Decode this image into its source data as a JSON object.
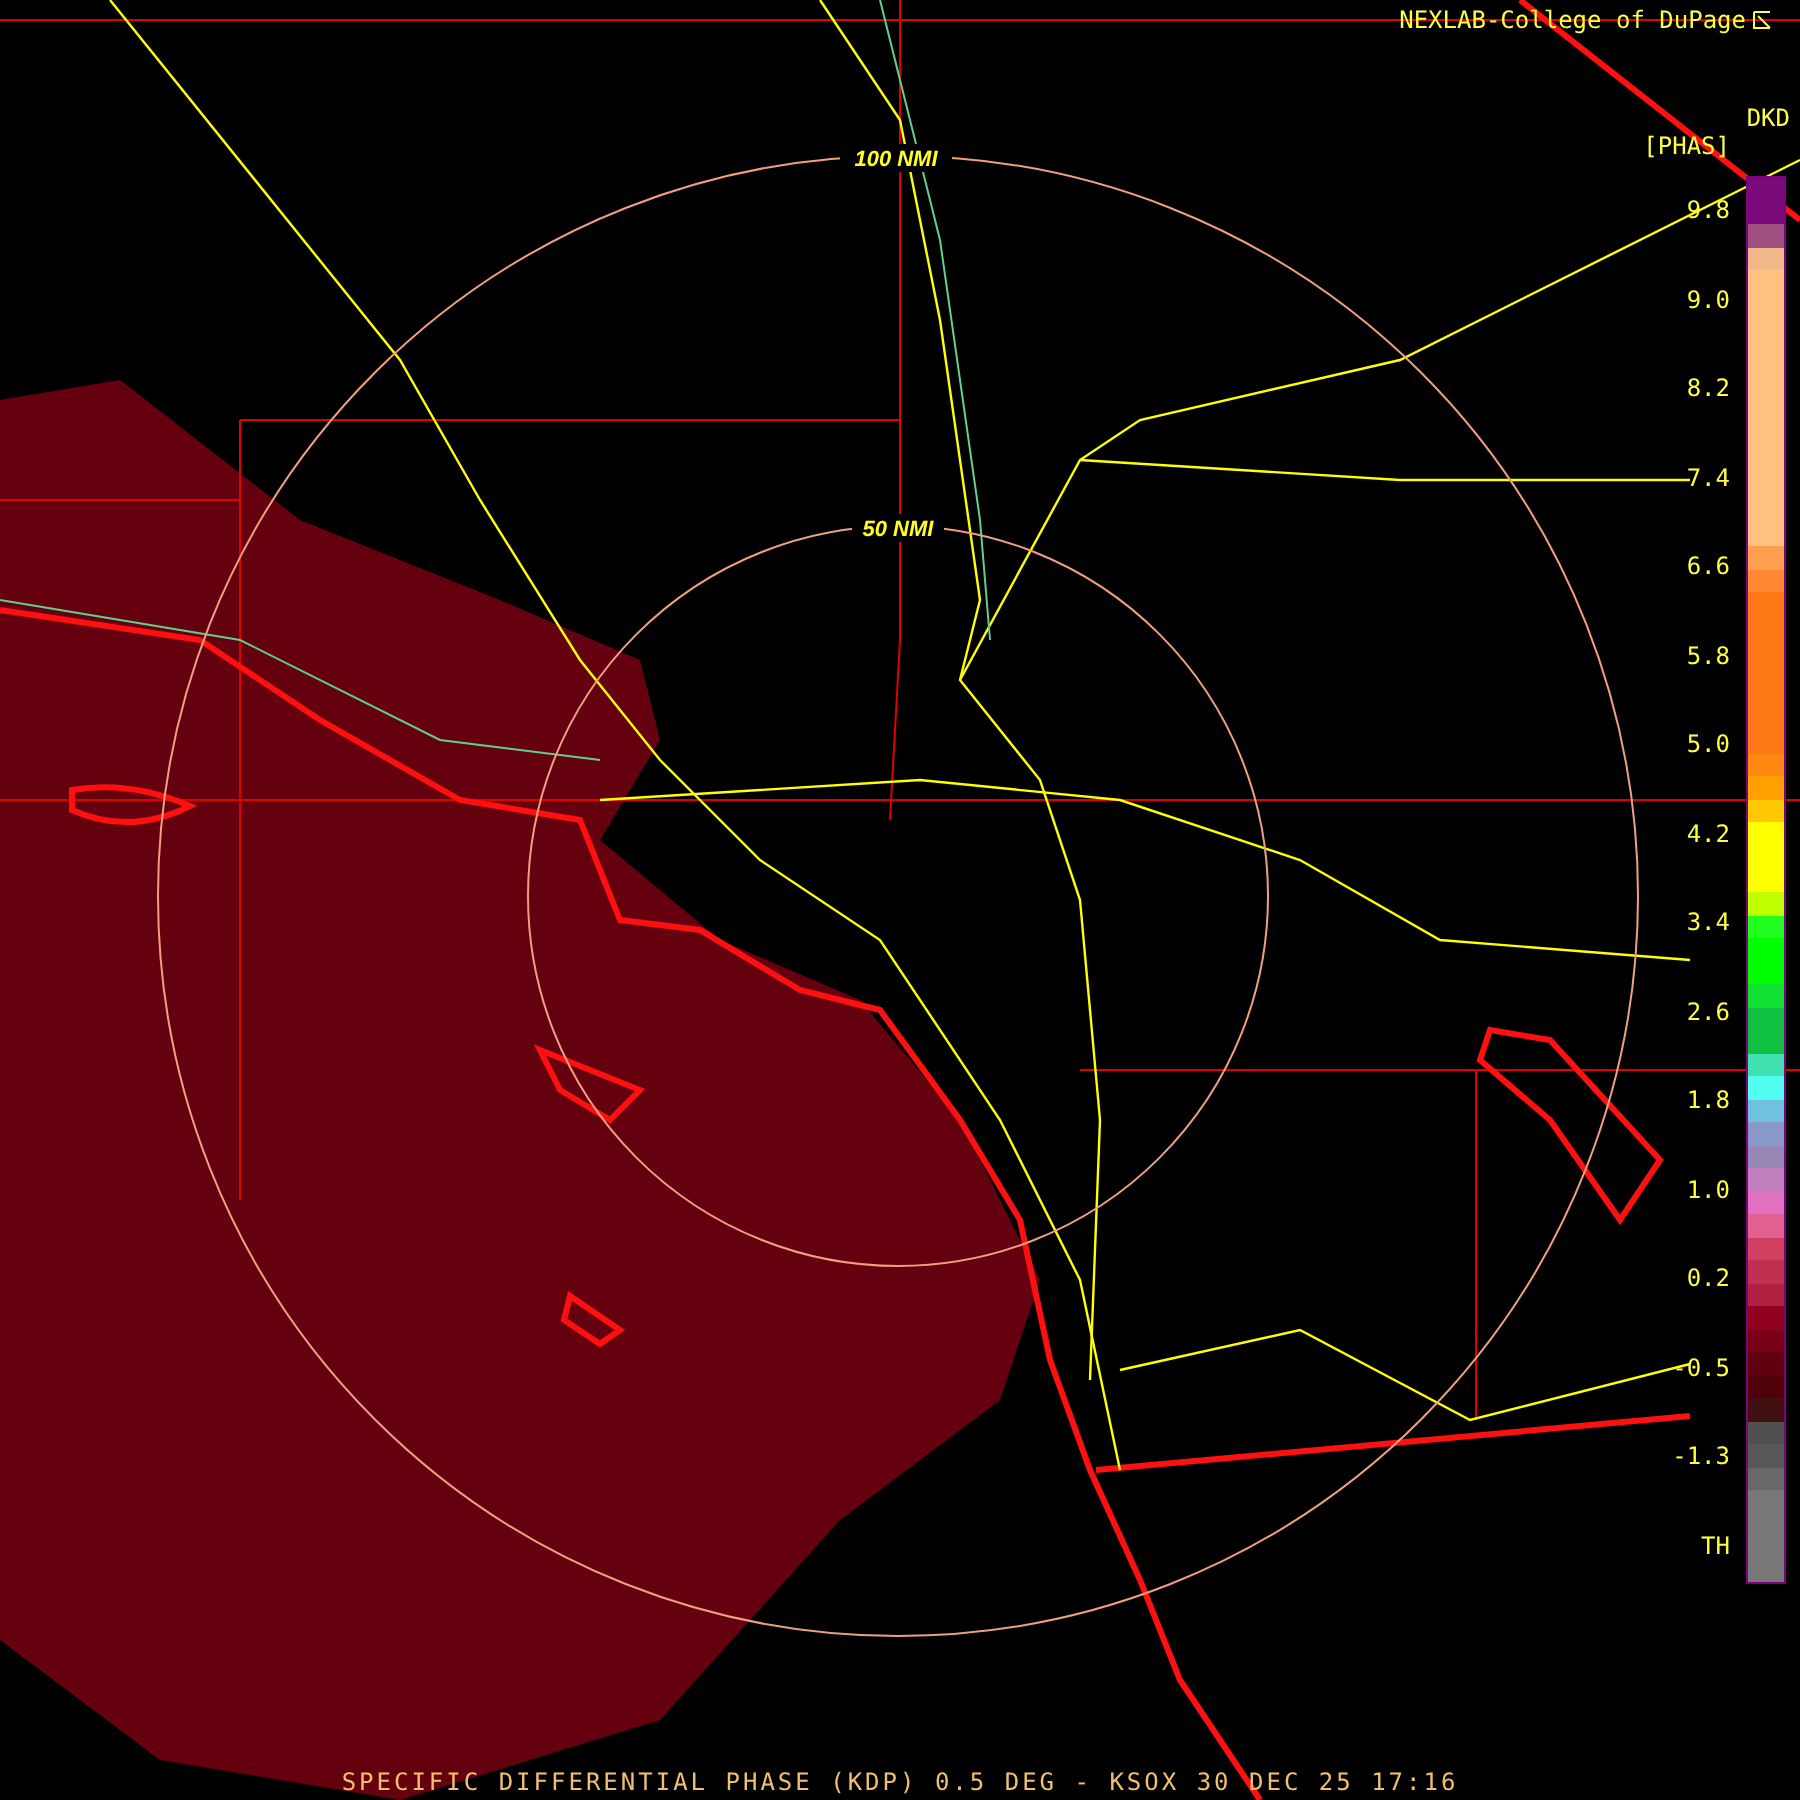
{
  "header": {
    "credit": "NEXLAB-College of DuPage"
  },
  "rings": [
    {
      "label": "100 NMI"
    },
    {
      "label": "50 NMI"
    }
  ],
  "legend": {
    "product": "DKD",
    "unit": "[PHAS]",
    "ticks": [
      "9.8",
      "9.0",
      "8.2",
      "7.4",
      "6.6",
      "5.8",
      "5.0",
      "4.2",
      "3.4",
      "2.6",
      "1.8",
      "1.0",
      "0.2",
      "-0.5",
      "-1.3",
      "TH"
    ],
    "bands": [
      {
        "color": "#7a0a7a"
      },
      {
        "color": "#7a0a7a"
      },
      {
        "color": "#a05080"
      },
      {
        "color": "#f0b888"
      },
      {
        "color": "#ffc080"
      },
      {
        "color": "#ffc080"
      },
      {
        "color": "#ffc080"
      },
      {
        "color": "#ffc080"
      },
      {
        "color": "#ffc080"
      },
      {
        "color": "#ffc080"
      },
      {
        "color": "#ffc080"
      },
      {
        "color": "#ffc080"
      },
      {
        "color": "#ffc080"
      },
      {
        "color": "#ffc080"
      },
      {
        "color": "#ffc080"
      },
      {
        "color": "#ffc080"
      },
      {
        "color": "#ffa050"
      },
      {
        "color": "#ff8830"
      },
      {
        "color": "#ff7818"
      },
      {
        "color": "#ff7818"
      },
      {
        "color": "#ff7818"
      },
      {
        "color": "#ff7818"
      },
      {
        "color": "#ff7818"
      },
      {
        "color": "#ff7818"
      },
      {
        "color": "#ff7818"
      },
      {
        "color": "#ff8810"
      },
      {
        "color": "#ffa000"
      },
      {
        "color": "#ffc800"
      },
      {
        "color": "#ffff00"
      },
      {
        "color": "#ffff00"
      },
      {
        "color": "#ffff00"
      },
      {
        "color": "#c0ff00"
      },
      {
        "color": "#20ff20"
      },
      {
        "color": "#00ff00"
      },
      {
        "color": "#00ff00"
      },
      {
        "color": "#10e030"
      },
      {
        "color": "#10c040"
      },
      {
        "color": "#10c040"
      },
      {
        "color": "#40e0b0"
      },
      {
        "color": "#50fff0"
      },
      {
        "color": "#70c0e0"
      },
      {
        "color": "#8898c8"
      },
      {
        "color": "#9888b8"
      },
      {
        "color": "#c080c0"
      },
      {
        "color": "#e070c0"
      },
      {
        "color": "#e06090"
      },
      {
        "color": "#d04060"
      },
      {
        "color": "#c03050"
      },
      {
        "color": "#b02040"
      },
      {
        "color": "#900020"
      },
      {
        "color": "#780018"
      },
      {
        "color": "#600010"
      },
      {
        "color": "#500008"
      },
      {
        "color": "#401010"
      },
      {
        "color": "#505050"
      },
      {
        "color": "#585858"
      },
      {
        "color": "#686868"
      },
      {
        "color": "#787878"
      },
      {
        "color": "#787878"
      },
      {
        "color": "#787878"
      },
      {
        "color": "#787878"
      }
    ]
  },
  "footer": {
    "caption": "SPECIFIC DIFFERENTIAL PHASE (KDP) 0.5 DEG - KSOX 30 DEC 25 17:16"
  }
}
